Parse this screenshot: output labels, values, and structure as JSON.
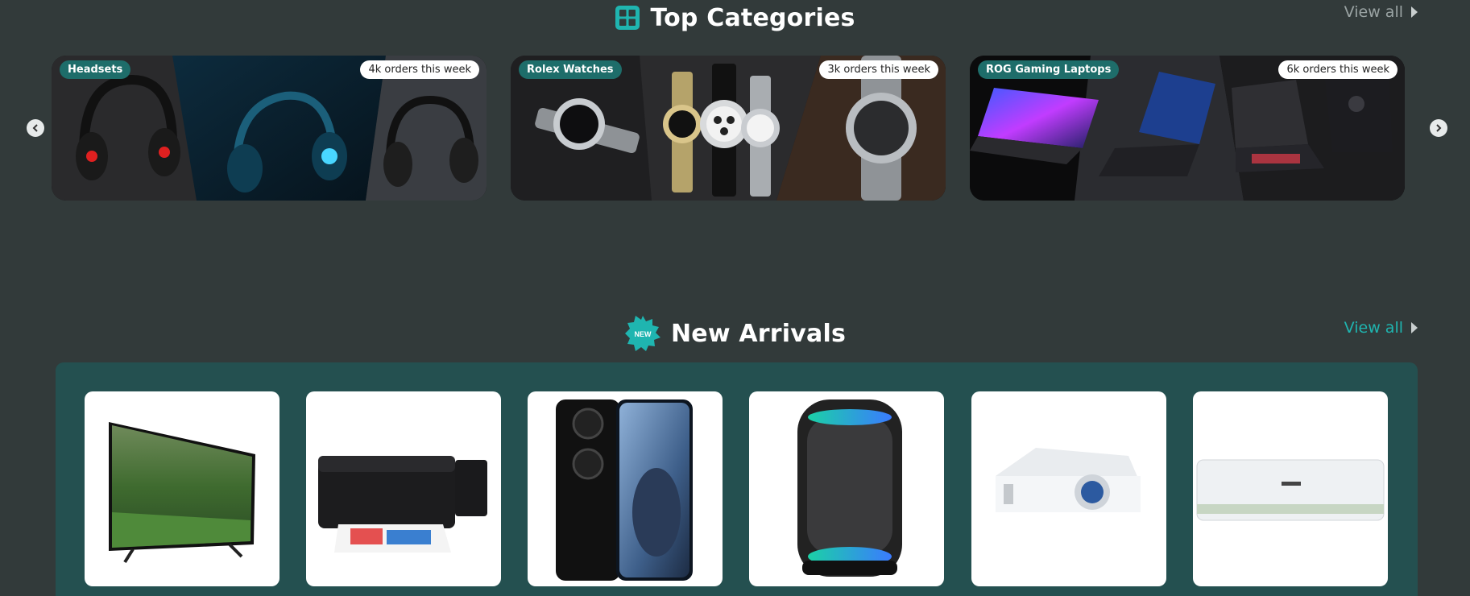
{
  "top_categories": {
    "title": "Top Categories",
    "title_icon": "grid-icon",
    "view_all_label": "View all",
    "cards": [
      {
        "label": "Headsets",
        "orders": "4k orders this week"
      },
      {
        "label": "Rolex Watches",
        "orders": "3k orders this week"
      },
      {
        "label": "ROG Gaming Laptops",
        "orders": "6k orders this week"
      }
    ]
  },
  "new_arrivals": {
    "title": "New Arrivals",
    "badge": "NEW",
    "view_all_label": "View all",
    "products": [
      {
        "name": "tv"
      },
      {
        "name": "printer"
      },
      {
        "name": "smartphone"
      },
      {
        "name": "speaker"
      },
      {
        "name": "projector"
      },
      {
        "name": "air-conditioner"
      }
    ]
  },
  "colors": {
    "background": "#323a3a",
    "accent": "#1fb5b0",
    "label_bg": "#1e6d6a",
    "panel": "#245050"
  }
}
